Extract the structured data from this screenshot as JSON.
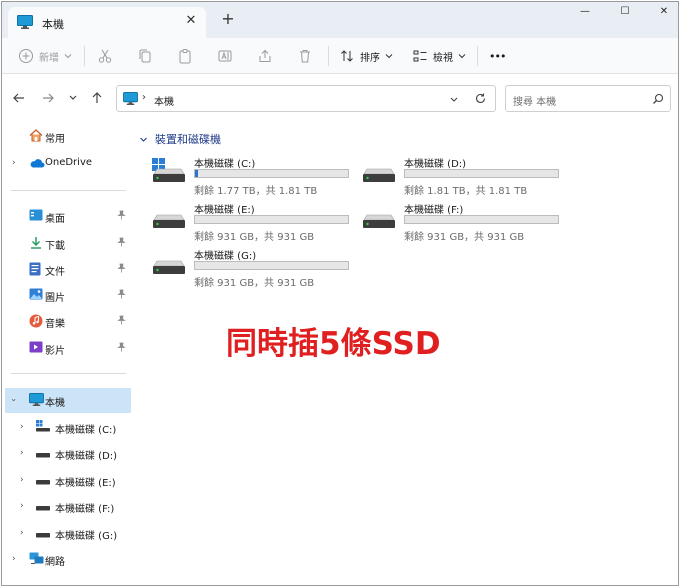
{
  "tab": {
    "title": "本機",
    "close": "✕",
    "add": "+"
  },
  "window_controls": {
    "minimize": "—",
    "maximize": "☐",
    "close": "✕"
  },
  "toolbar": {
    "new_label": "新增",
    "sort_label": "排序",
    "view_label": "檢視",
    "more_label": "•••"
  },
  "address": {
    "separator": "›",
    "location": "本機"
  },
  "search": {
    "placeholder": "搜尋 本機"
  },
  "sidebar": {
    "quick_access": {
      "label": "常用"
    },
    "onedrive": {
      "label": "OneDrive"
    },
    "pinned": [
      {
        "label": "桌面",
        "icon": "desktop-icon"
      },
      {
        "label": "下載",
        "icon": "download-icon"
      },
      {
        "label": "文件",
        "icon": "documents-icon"
      },
      {
        "label": "圖片",
        "icon": "pictures-icon"
      },
      {
        "label": "音樂",
        "icon": "music-icon"
      },
      {
        "label": "影片",
        "icon": "videos-icon"
      }
    ],
    "this_pc": {
      "label": "本機"
    },
    "drives": [
      {
        "label": "本機磁碟 (C:)"
      },
      {
        "label": "本機磁碟 (D:)"
      },
      {
        "label": "本機磁碟 (E:)"
      },
      {
        "label": "本機磁碟 (F:)"
      },
      {
        "label": "本機磁碟 (G:)"
      }
    ],
    "network": {
      "label": "網路"
    }
  },
  "main": {
    "group_title": "裝置和磁碟機",
    "drives": [
      {
        "name": "本機磁碟 (C:)",
        "info": "剩餘 1.77 TB，共 1.81 TB",
        "used_fraction": 0.02,
        "system": true
      },
      {
        "name": "本機磁碟 (D:)",
        "info": "剩餘 1.81 TB，共 1.81 TB",
        "used_fraction": 0.0,
        "system": false
      },
      {
        "name": "本機磁碟 (E:)",
        "info": "剩餘 931 GB，共 931 GB",
        "used_fraction": 0.0,
        "system": false
      },
      {
        "name": "本機磁碟 (F:)",
        "info": "剩餘 931 GB，共 931 GB",
        "used_fraction": 0.0,
        "system": false
      },
      {
        "name": "本機磁碟 (G:)",
        "info": "剩餘 931 GB，共 931 GB",
        "used_fraction": 0.0,
        "system": false
      }
    ],
    "overlay_text": "同時插5條SSD"
  },
  "colors": {
    "accent": "#2b73d7",
    "overlay": "#e02020",
    "selection": "#cce4f7",
    "group_header": "#1f3a8a"
  }
}
